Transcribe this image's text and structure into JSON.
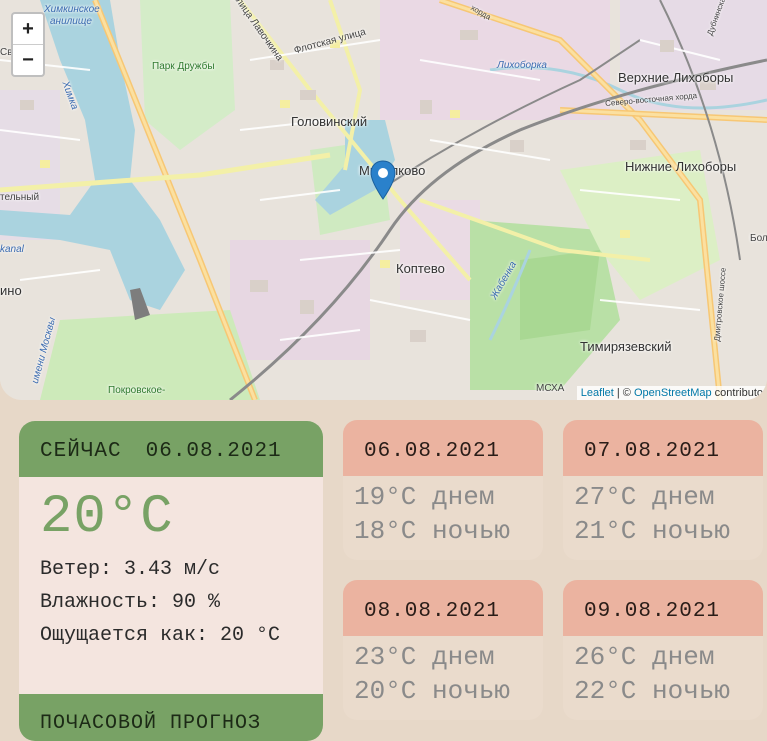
{
  "map": {
    "zoom_in": "+",
    "zoom_out": "−",
    "labels": {
      "golovinsky": "Головинский",
      "mikhalkovo": "Михалково",
      "koptevo": "Коптево",
      "verkhnie": "Верхние Лихоборы",
      "nizhnie": "Нижние Лихоборы",
      "timiryazevsky": "Тимирязевский",
      "park_druzhby": "Парк Дружбы",
      "khimkinskoe": "Химкинское",
      "vodokhranilishche": "анилище",
      "svobody": "Свобод",
      "flotskaya": "Флотская улица",
      "lavochkina": "улица Лавочкина",
      "likhoborka": "Лихоборка",
      "severo": "Северо-восточная хорда",
      "zhabenka": "Жабенка",
      "pokrovskoe": "Покровское-",
      "msha": "МСХА",
      "kanal": "kanal",
      "ino": "ино",
      "bol": "Бол",
      "khimka": "Химка",
      "atelny": "тельный",
      "dmitrovskoe": "Дмитровское шоссе",
      "im_moskvy": "имени Москвы",
      "ordy": "хорда",
      "dubninskaya": "Дубнинская"
    },
    "attribution": {
      "leaflet": "Leaflet",
      "sep": " | © ",
      "osm": "OpenStreetMap",
      "contrib": " contributo"
    },
    "marker_icon": "map-pin-icon"
  },
  "current": {
    "label": "СЕЙЧАС",
    "date": "06.08.2021",
    "temp": "20°C",
    "wind": "Ветер: 3.43 м/с",
    "humidity": "Влажность: 90 %",
    "feels": "Ощущается как: 20 °C",
    "hourly_title": "ПОЧАСОВОЙ ПРОГНОЗ"
  },
  "forecast": [
    {
      "date": "06.08.2021",
      "day": "19°C днем",
      "night": "18°C ночью"
    },
    {
      "date": "07.08.2021",
      "day": "27°C днем",
      "night": "21°C ночью"
    },
    {
      "date": "08.08.2021",
      "day": "23°C днем",
      "night": "20°C ночью"
    },
    {
      "date": "09.08.2021",
      "day": "26°C днем",
      "night": "22°C ночью"
    }
  ],
  "colors": {
    "page_bg": "#e7d8c8",
    "accent_green": "#78a265",
    "accent_salmon": "#ebb3a0",
    "card_bg": "#f4e5df"
  }
}
